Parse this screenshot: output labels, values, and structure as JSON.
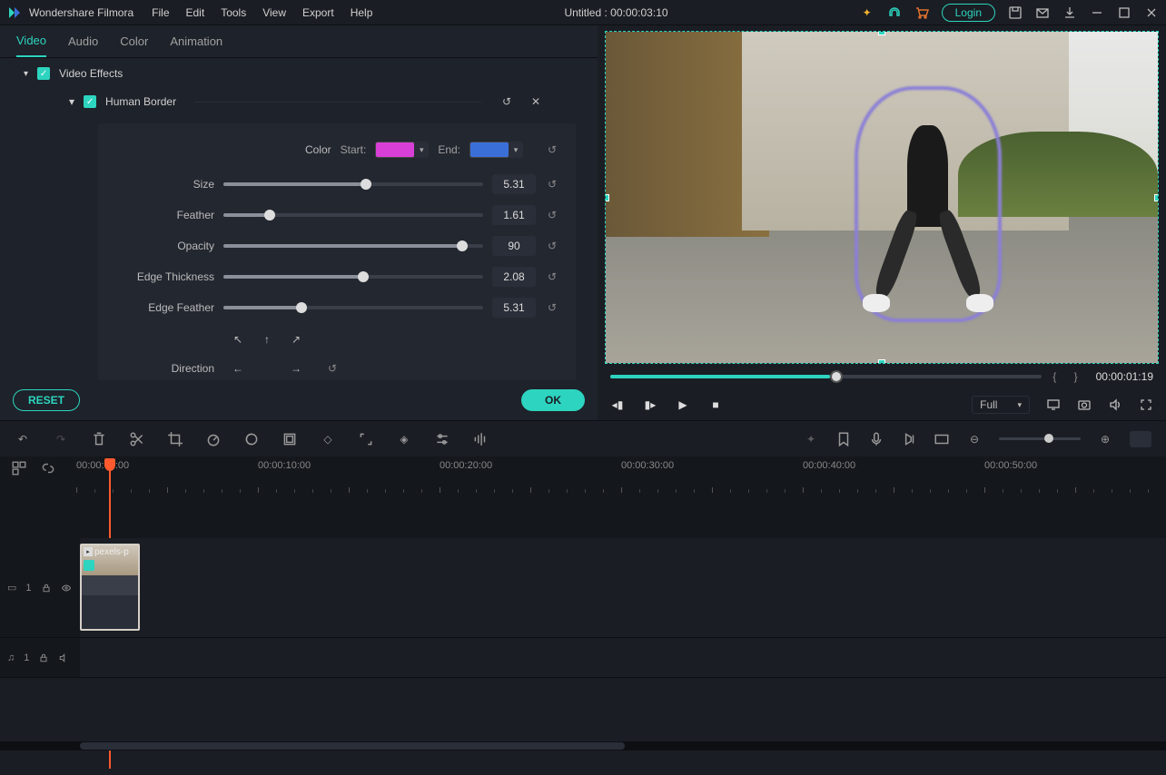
{
  "app": {
    "name": "Wondershare Filmora",
    "title": "Untitled : 00:00:03:10",
    "login_label": "Login"
  },
  "menus": [
    "File",
    "Edit",
    "Tools",
    "View",
    "Export",
    "Help"
  ],
  "tabs": [
    "Video",
    "Audio",
    "Color",
    "Animation"
  ],
  "section": {
    "video_effects": "Video Effects",
    "human_border": "Human Border"
  },
  "color_row": {
    "label": "Color",
    "start_label": "Start:",
    "end_label": "End:",
    "start_color": "#d83fd6",
    "end_color": "#3a6fd8"
  },
  "sliders": {
    "size": {
      "label": "Size",
      "value": "5.31",
      "pct": 55
    },
    "feather": {
      "label": "Feather",
      "value": "1.61",
      "pct": 18
    },
    "opacity": {
      "label": "Opacity",
      "value": "90",
      "pct": 92
    },
    "edge_thickness": {
      "label": "Edge Thickness",
      "value": "2.08",
      "pct": 54
    },
    "edge_feather": {
      "label": "Edge Feather",
      "value": "5.31",
      "pct": 30
    }
  },
  "direction_label": "Direction",
  "buttons": {
    "reset": "RESET",
    "ok": "OK"
  },
  "preview": {
    "timecode": "00:00:01:19",
    "quality": "Full"
  },
  "timeline": {
    "marks": [
      "00:00:00:00",
      "00:00:10:00",
      "00:00:20:00",
      "00:00:30:00",
      "00:00:40:00",
      "00:00:50:00"
    ],
    "clip_label": "pexels-p",
    "video_track": "1",
    "audio_track": "1"
  }
}
